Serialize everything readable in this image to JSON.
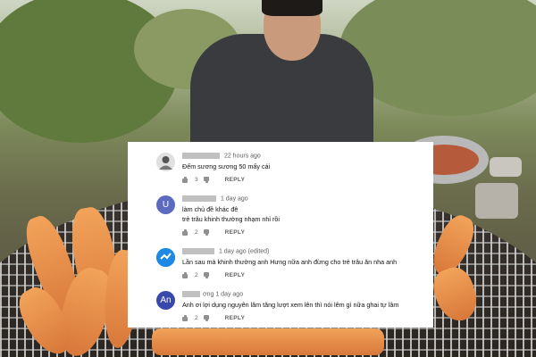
{
  "comments": [
    {
      "avatar_icon": "user-avatar-icon",
      "avatar_color": "#e7e7e7",
      "avatar_initials": "",
      "name": "",
      "time": "22 hours ago",
      "text": "Đếm sương sương 50 mấy cái",
      "likes": "3",
      "reply_label": "REPLY"
    },
    {
      "avatar_icon": "user-avatar-icon",
      "avatar_color": "#5c6bc0",
      "avatar_initials": "U",
      "name": "",
      "time": "1 day ago",
      "text_line1": "làm chủ đề khác đê",
      "text_line2": "trẻ trâu khinh thường nhạm nhỉ rồi",
      "likes": "2",
      "reply_label": "REPLY"
    },
    {
      "avatar_icon": "user-avatar-icon",
      "avatar_color": "#1e88e5",
      "avatar_initials": "",
      "name": "",
      "time": "1 day ago (edited)",
      "text": "Lần sau mà khinh thường anh Hưng nữa anh đừng cho trẻ trâu ăn nha anh",
      "likes": "2",
      "reply_label": "REPLY"
    },
    {
      "avatar_icon": "user-avatar-icon",
      "avatar_color": "#3949ab",
      "avatar_initials": "An",
      "name": "ơng",
      "time": "1 day ago",
      "text": "Anh ơi lợi dụng nguyên lăm tăng lượt xem lên thì nói lêm gì nữa ghai tự lâm",
      "likes": "2",
      "reply_label": "REPLY"
    }
  ],
  "colors": {
    "panel_bg": "#ffffff",
    "meta_text": "#606060",
    "comment_text": "#111111"
  }
}
